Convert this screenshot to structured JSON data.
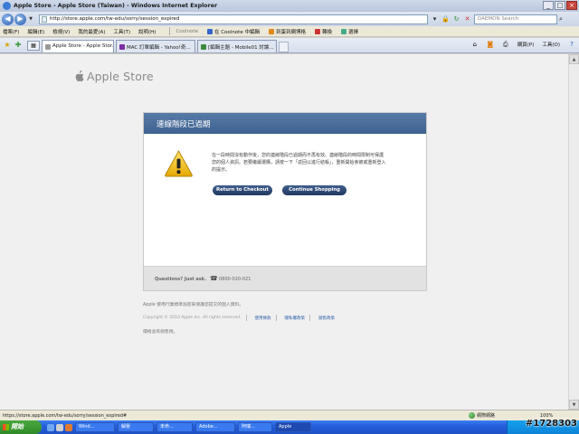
{
  "window": {
    "title": "Apple Store - Apple Store (Taiwan) - Windows Internet Explorer",
    "minimize": "_",
    "maximize": "□",
    "close": "×"
  },
  "address_bar": {
    "url": "http://store.apple.com/tw-edu/sorry/session_expired",
    "search_placeholder": "DAEMON Search"
  },
  "menu": {
    "items": [
      "檔案(F)",
      "編輯(E)",
      "檢視(V)",
      "我的最愛(A)",
      "工具(T)",
      "說明(H)"
    ],
    "links": [
      "Coolnote",
      "在 Coolnote 中編輯",
      "到蛋到網博格",
      "轉換",
      "選擇"
    ]
  },
  "tabs": [
    {
      "label": "Apple Store - Apple Stor...",
      "active": true
    },
    {
      "label": "MAC 訂單編輯 - Yahoo!奇...",
      "active": false
    },
    {
      "label": "[編輯主題 - Mobile01 討論...",
      "active": false
    }
  ],
  "command_bar": {
    "page": "網頁(P)",
    "tools": "工具(O)"
  },
  "page": {
    "brand": "Apple Store",
    "header": "連線階段已過期",
    "message": "在一段時間沒有動作後，您的連線階段已過期而不再有效。連線階段的時間限制可保護您的個人資訊。若要繼續選購，請按一下「返回以進行結帳」，重新開始會被或重新登入的提示。",
    "return_button": "Return to Checkout",
    "continue_button": "Continue Shopping",
    "questions": "Questions? Just ask.",
    "phone": "0800-020-021",
    "note": "Apple 使用行業標準加密來保護您提交的個人資料。",
    "copyright": "Copyright © 2010 Apple Inc. All rights reserved.",
    "footer_links": [
      "使用條款",
      "隱私權政策",
      "銷售政策"
    ],
    "subnote": "價格含有銷售稅。"
  },
  "status_bar": {
    "url": "https://store.apple.com/tw-edu/sorry/session_expired#",
    "zone": "網際網路",
    "zoom": "100%"
  },
  "taskbar": {
    "start": "開始",
    "items": [
      "Wind...",
      "解壓",
      "未命...",
      "Adobe...",
      "阿瑞...",
      "Apple"
    ]
  },
  "watermark": "#1728303"
}
